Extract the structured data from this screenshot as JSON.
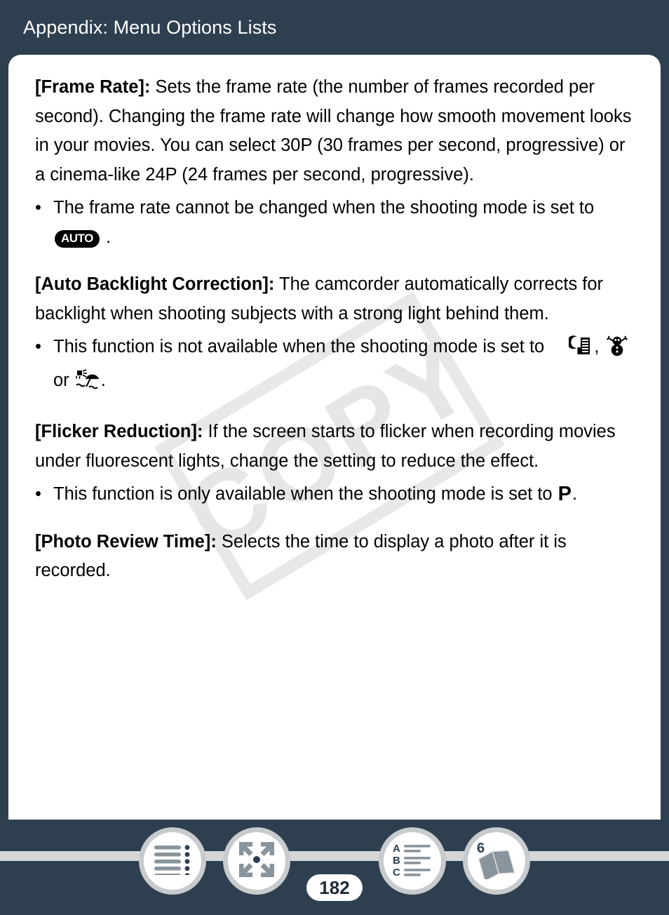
{
  "header": {
    "title": "Appendix: Menu Options Lists"
  },
  "watermark": {
    "text": "COPY"
  },
  "content": {
    "sections": [
      {
        "term": "[Frame Rate]:",
        "text": " Sets the frame rate (the number of frames recorded per second). Changing the frame rate will change how smooth movement looks in your movies. You can select 30P (30 frames per second, progressive) or a cinema-like 24P (24 frames per second, progressive).",
        "bullet_lead": "The frame rate cannot be changed when the shooting mode is set to ",
        "bullet_badge": "AUTO",
        "bullet_tail": " ."
      },
      {
        "term": "[Auto Backlight Correction]:",
        "text": " The camcorder automatically corrects for backlight when shooting subjects with a strong light behind them.",
        "bullet_lead": "This function is not available when the shooting mode is set to",
        "icon_separator_1": ",",
        "icon_separator_2": "or",
        "icon_tail": "."
      },
      {
        "term": "[Flicker Reduction]:",
        "text": " If the screen starts to flicker when recording movies under fluorescent lights, change the setting to reduce the effect.",
        "bullet_lead": "This function is only available when the shooting mode is set ",
        "bullet_to": "to ",
        "bullet_mode": "P",
        "bullet_tail": "."
      },
      {
        "term": "[Photo Review Time]:",
        "text": " Selects the time to display a photo after it is recorded."
      }
    ]
  },
  "footer": {
    "page_number": "182",
    "book_count": "6",
    "index_letters": [
      "A",
      "B",
      "C"
    ],
    "buttons": [
      {
        "name": "table-of-contents",
        "label": "Table of Contents"
      },
      {
        "name": "fullscreen",
        "label": "Fit Page"
      },
      {
        "name": "index",
        "label": "Index"
      },
      {
        "name": "library",
        "label": "Library"
      }
    ]
  },
  "colors": {
    "background": "#2e3f50",
    "card": "#ffffff",
    "rail": "#d4d6d8",
    "button_border": "#c8cbcd",
    "icon_gray": "#8a949c",
    "icon_navy": "#2e3f50",
    "watermark": "#e6e6e6"
  }
}
